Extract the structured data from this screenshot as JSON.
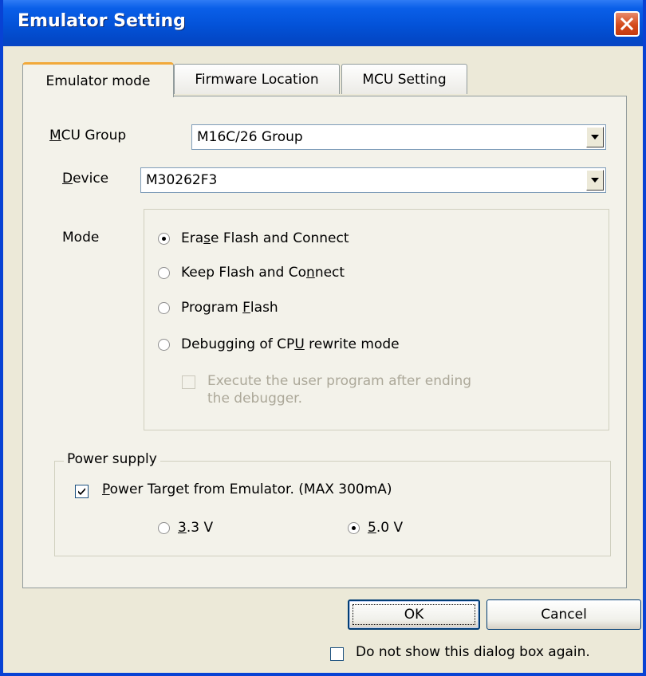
{
  "window": {
    "title": "Emulator Setting"
  },
  "tabs": [
    {
      "label": "Emulator mode"
    },
    {
      "label": "Firmware Location"
    },
    {
      "label": "MCU Setting"
    }
  ],
  "mcu_group": {
    "label_first": "M",
    "label_rest": "CU Group",
    "value": "M16C/26 Group"
  },
  "device": {
    "label_first": "D",
    "label_rest": "evice",
    "value": "M30262F3"
  },
  "mode": {
    "label": "Mode",
    "options": [
      {
        "pre": "Era",
        "key": "s",
        "post": "e Flash and Connect",
        "selected": true
      },
      {
        "pre": "Keep Flash and Co",
        "key": "n",
        "post": "nect",
        "selected": false
      },
      {
        "pre": "Program ",
        "key": "F",
        "post": "lash",
        "selected": false
      },
      {
        "pre": "Debugging of CP",
        "key": "U",
        "post": " rewrite mode",
        "selected": false
      }
    ],
    "execute_after_line1": "Execute the user program after ending",
    "execute_after_line2": "the debugger."
  },
  "power": {
    "group_title": "Power supply",
    "target_key": "P",
    "target_rest": "ower Target from Emulator. (MAX 300mA)",
    "target_checked": true,
    "v33_key": "3",
    "v33_rest": ".3 V",
    "v50_key": "5",
    "v50_rest": ".0 V",
    "selected_voltage": "5.0 V"
  },
  "buttons": {
    "ok": "OK",
    "cancel": "Cancel"
  },
  "footer": {
    "dont_show": "Do not show this dialog box again."
  }
}
